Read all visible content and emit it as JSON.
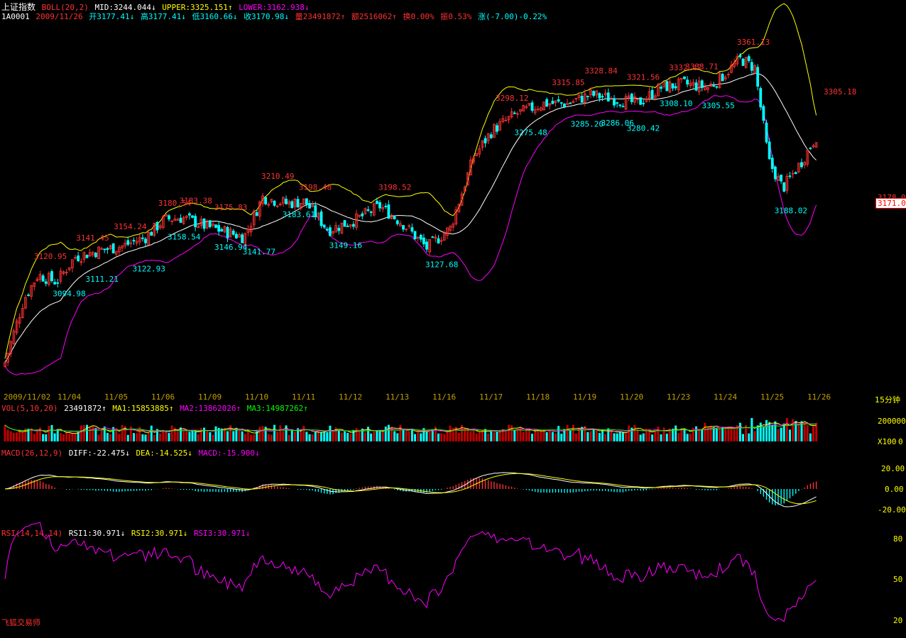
{
  "header": {
    "index_name": "上证指数",
    "boll_label": "BOLL(20,2)",
    "mid": "MID:3244.044↓",
    "upper": "UPPER:3325.151↑",
    "lower": "LOWER:3162.938↓",
    "code": "1A0001",
    "date": "2009/11/26",
    "open": "开3177.41↓",
    "high": "高3177.41↓",
    "low": "低3160.66↓",
    "close": "收3170.98↓",
    "volume": "量23491872↑",
    "amount": "额2516062↑",
    "turnover": "换0.00%",
    "amplitude": "振0.53%",
    "change": "涨(-7.00)-0.22%"
  },
  "vol_header": {
    "label": "VOL(5,10,20)",
    "vol": "23491872↑",
    "ma1": "MA1:15853885↑",
    "ma2": "MA2:13862026↑",
    "ma3": "MA3:14987262↑"
  },
  "macd_header": {
    "label": "MACD(26,12,9)",
    "diff": "DIFF:-22.475↓",
    "dea": "DEA:-14.525↓",
    "macd": "MACD:-15.900↓"
  },
  "rsi_header": {
    "label": "RSI(14,14,14)",
    "rsi1": "RSI1:30.971↓",
    "rsi2": "RSI2:30.971↓",
    "rsi3": "RSI3:30.971↓"
  },
  "footer_text": "飞狐交易师",
  "period_label": "15分钟",
  "price_tag": "3171.0",
  "price_axis_label": "3178.0",
  "chart_data": [
    {
      "type": "candlestick",
      "title": "上证指数 BOLL(20,2)",
      "x": [
        "2009/11/02",
        "11/04",
        "11/05",
        "11/06",
        "11/09",
        "11/10",
        "11/11",
        "11/12",
        "11/13",
        "11/16",
        "11/17",
        "11/18",
        "11/19",
        "11/20",
        "11/23",
        "11/24",
        "11/25",
        "11/26"
      ],
      "y_range": [
        2980,
        3400
      ],
      "last_price": 3171.0,
      "price_annotations": [
        {
          "label": "3120.95",
          "value": 3120.95,
          "day": 0.65,
          "kind": "high"
        },
        {
          "label": "3094.98",
          "value": 3094.98,
          "day": 1.05,
          "kind": "low"
        },
        {
          "label": "3141.45",
          "value": 3141.45,
          "day": 1.55,
          "kind": "high"
        },
        {
          "label": "3111.21",
          "value": 3111.21,
          "day": 1.75,
          "kind": "low"
        },
        {
          "label": "3154.24",
          "value": 3154.24,
          "day": 2.35,
          "kind": "high"
        },
        {
          "label": "3122.93",
          "value": 3122.93,
          "day": 2.75,
          "kind": "low"
        },
        {
          "label": "3180.54",
          "value": 3180.54,
          "day": 3.3,
          "kind": "high"
        },
        {
          "label": "3183.38",
          "value": 3183.38,
          "day": 3.75,
          "kind": "high"
        },
        {
          "label": "3158.54",
          "value": 3158.54,
          "day": 3.5,
          "kind": "low"
        },
        {
          "label": "3175.83",
          "value": 3175.83,
          "day": 4.5,
          "kind": "high"
        },
        {
          "label": "3146.94",
          "value": 3146.94,
          "day": 4.5,
          "kind": "low"
        },
        {
          "label": "3141.77",
          "value": 3141.77,
          "day": 5.1,
          "kind": "low"
        },
        {
          "label": "3210.49",
          "value": 3210.49,
          "day": 5.5,
          "kind": "high"
        },
        {
          "label": "3183.61",
          "value": 3183.61,
          "day": 5.95,
          "kind": "low"
        },
        {
          "label": "3198.48",
          "value": 3198.48,
          "day": 6.3,
          "kind": "high"
        },
        {
          "label": "3149.16",
          "value": 3149.16,
          "day": 6.95,
          "kind": "low"
        },
        {
          "label": "3198.52",
          "value": 3198.52,
          "day": 8.0,
          "kind": "high"
        },
        {
          "label": "3127.68",
          "value": 3127.68,
          "day": 9.0,
          "kind": "low"
        },
        {
          "label": "3298.12",
          "value": 3298.12,
          "day": 10.5,
          "kind": "high"
        },
        {
          "label": "3275.48",
          "value": 3275.48,
          "day": 10.9,
          "kind": "low"
        },
        {
          "label": "3315.85",
          "value": 3315.85,
          "day": 11.7,
          "kind": "high"
        },
        {
          "label": "3328.84",
          "value": 3328.84,
          "day": 12.4,
          "kind": "high"
        },
        {
          "label": "3285.20",
          "value": 3285.2,
          "day": 12.1,
          "kind": "low"
        },
        {
          "label": "3286.06",
          "value": 3286.06,
          "day": 12.75,
          "kind": "low"
        },
        {
          "label": "3321.56",
          "value": 3321.56,
          "day": 13.3,
          "kind": "high"
        },
        {
          "label": "3280.42",
          "value": 3280.42,
          "day": 13.3,
          "kind": "low"
        },
        {
          "label": "3332.47",
          "value": 3332.47,
          "day": 14.2,
          "kind": "high"
        },
        {
          "label": "3333.71",
          "value": 3333.71,
          "day": 14.55,
          "kind": "high"
        },
        {
          "label": "3308.10",
          "value": 3308.1,
          "day": 14.0,
          "kind": "low"
        },
        {
          "label": "3305.55",
          "value": 3305.55,
          "day": 14.9,
          "kind": "low"
        },
        {
          "label": "3361.13",
          "value": 3361.13,
          "day": 15.65,
          "kind": "high"
        },
        {
          "label": "3305.18",
          "value": 3305.18,
          "day": 17.5,
          "kind": "high"
        },
        {
          "label": "3188.02",
          "value": 3188.02,
          "day": 16.45,
          "kind": "low"
        }
      ],
      "series": [
        {
          "name": "MID",
          "value": 3244.044,
          "color": "#ffffff"
        },
        {
          "name": "UPPER",
          "value": 3325.151,
          "color": "#ffff00"
        },
        {
          "name": "LOWER",
          "value": 3162.938,
          "color": "#ff00ff"
        }
      ]
    },
    {
      "type": "bar",
      "title": "VOL(5,10,20)",
      "y_ticks": [
        "200000",
        "0"
      ],
      "y_unit": "X100",
      "series": [
        {
          "name": "MA1",
          "value": 15853885,
          "color": "#ffff00"
        },
        {
          "name": "MA2",
          "value": 13862026,
          "color": "#ff00ff"
        },
        {
          "name": "MA3",
          "value": 14987262,
          "color": "#00ff00"
        }
      ]
    },
    {
      "type": "bar",
      "title": "MACD(26,12,9)",
      "y_ticks": [
        "20.00",
        "0.00",
        "-20.00"
      ],
      "series": [
        {
          "name": "DIFF",
          "value": -22.475,
          "color": "#ffffff"
        },
        {
          "name": "DEA",
          "value": -14.525,
          "color": "#ffff00"
        },
        {
          "name": "MACD",
          "value": -15.9,
          "color": "#ff00ff"
        }
      ]
    },
    {
      "type": "line",
      "title": "RSI(14,14,14)",
      "y_ticks": [
        "80",
        "50",
        "20"
      ],
      "series": [
        {
          "name": "RSI1",
          "value": 30.971,
          "color": "#ffffff"
        },
        {
          "name": "RSI2",
          "value": 30.971,
          "color": "#ffff00"
        },
        {
          "name": "RSI3",
          "value": 30.971,
          "color": "#ff00ff"
        }
      ]
    }
  ]
}
